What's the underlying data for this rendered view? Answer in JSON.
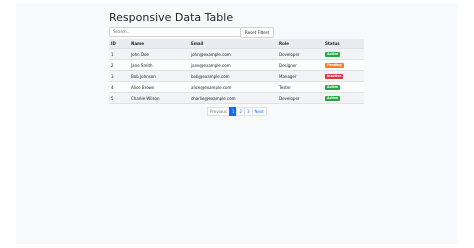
{
  "page": {
    "title": "Responsive Data Table"
  },
  "controls": {
    "search_placeholder": "Search...",
    "reset_label": "Reset Filters"
  },
  "table": {
    "columns": [
      "ID",
      "Name",
      "Email",
      "Role",
      "Status"
    ],
    "rows": [
      {
        "id": "1",
        "name": "John Doe",
        "email": "john@example.com",
        "role": "Developer",
        "status": "Active"
      },
      {
        "id": "2",
        "name": "Jane Smith",
        "email": "jane@example.com",
        "role": "Designer",
        "status": "Pending"
      },
      {
        "id": "3",
        "name": "Bob Johnson",
        "email": "bob@example.com",
        "role": "Manager",
        "status": "Inactive"
      },
      {
        "id": "4",
        "name": "Alice Brown",
        "email": "alice@example.com",
        "role": "Tester",
        "status": "Active"
      },
      {
        "id": "5",
        "name": "Charlie Wilson",
        "email": "charlie@example.com",
        "role": "Developer",
        "status": "Active"
      }
    ]
  },
  "status_colors": {
    "Active": "#28a745",
    "Pending": "#fd7e14",
    "Inactive": "#dc3545"
  },
  "pagination": {
    "previous_label": "Previous",
    "pages": [
      "1",
      "2",
      "3"
    ],
    "current_page": "1",
    "next_label": "Next"
  }
}
